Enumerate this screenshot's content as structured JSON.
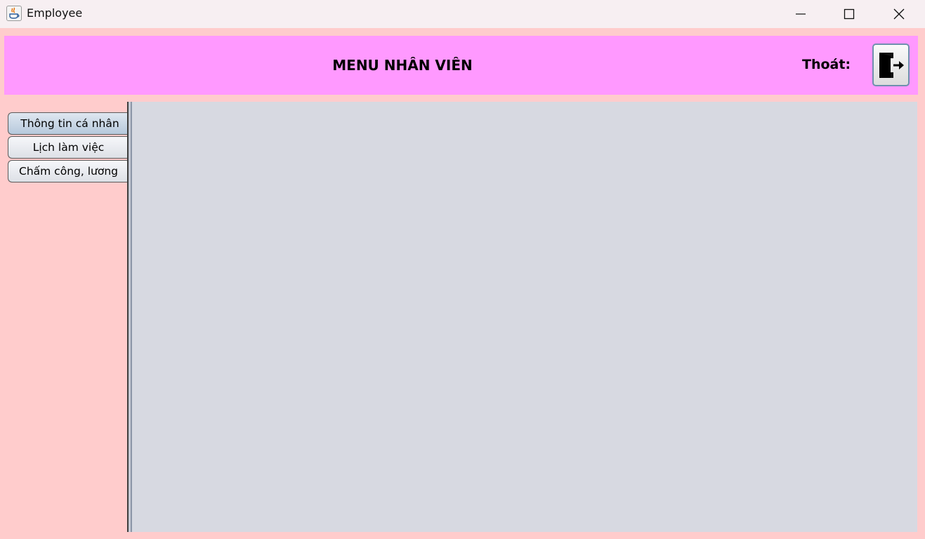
{
  "window": {
    "title": "Employee",
    "icon": "java-icon",
    "controls": [
      "minimize-icon",
      "maximize-icon",
      "close-icon"
    ]
  },
  "header": {
    "title": "MENU NHÂN VIÊN",
    "exit_label": "Thoát:",
    "exit_icon": "exit-door-icon",
    "background": "#ff99ff"
  },
  "sidebar": {
    "tabs": [
      {
        "label": "Thông tin cá nhân",
        "selected": true
      },
      {
        "label": "Lịch làm việc",
        "selected": false
      },
      {
        "label": "Chấm công, lương",
        "selected": false
      }
    ]
  },
  "colors": {
    "window_background": "#ffcccc",
    "content_panel": "#d7d9e1",
    "selected_tab": "#b6c9dc"
  }
}
